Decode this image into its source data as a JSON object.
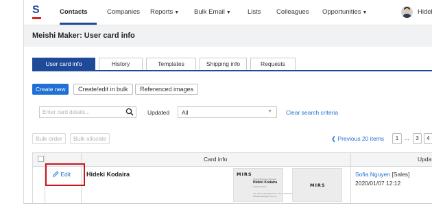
{
  "nav": {
    "items": [
      "Contacts",
      "Companies",
      "Reports",
      "Bulk Email",
      "Lists",
      "Colleagues",
      "Opportunities"
    ],
    "active": "Contacts",
    "user_name": "Hideki K"
  },
  "page": {
    "title": "Meishi Maker: User card info"
  },
  "tabs": [
    "User card info",
    "History",
    "Templates",
    "Shipping info",
    "Requests"
  ],
  "toolbar": {
    "create_new": "Create new",
    "create_edit_bulk": "Create/edit in bulk",
    "referenced_images": "Referenced images"
  },
  "filter": {
    "search_placeholder": "Enter card details...",
    "updated_label": "Updated",
    "updated_value": "All",
    "clear_label": "Clear search criteria"
  },
  "bulk": {
    "bulk_order": "Bulk order",
    "bulk_allocate": "Bulk allocate",
    "previous": "Previous 20 items",
    "pages": [
      "1",
      "...",
      "3",
      "4"
    ]
  },
  "table": {
    "headers": {
      "card_info": "Card info",
      "updated": "Updated"
    },
    "rows": [
      {
        "edit_label": "Edit",
        "name": "Hideki Kodaira",
        "card_front": {
          "company": "MIRS",
          "title_line": "Global Business Manager",
          "person": "Hideki Kodaira",
          "person_kana": "Kodaira Hideki",
          "contact_line1": "Tel: +81-3-1234-5678  Fax: +81-3-1234-5679",
          "contact_line2": "hideki.kodaira@mirs.co.jp"
        },
        "card_back": {
          "company": "MIRS"
        },
        "updated_by": "Sofia Nguyen",
        "updated_role": "[Sales]",
        "updated_at": "2020/01/07 12:12"
      }
    ]
  },
  "colors": {
    "brand": "#1f4a9a",
    "accent": "#1f6fd6",
    "highlight": "#c8161d"
  }
}
